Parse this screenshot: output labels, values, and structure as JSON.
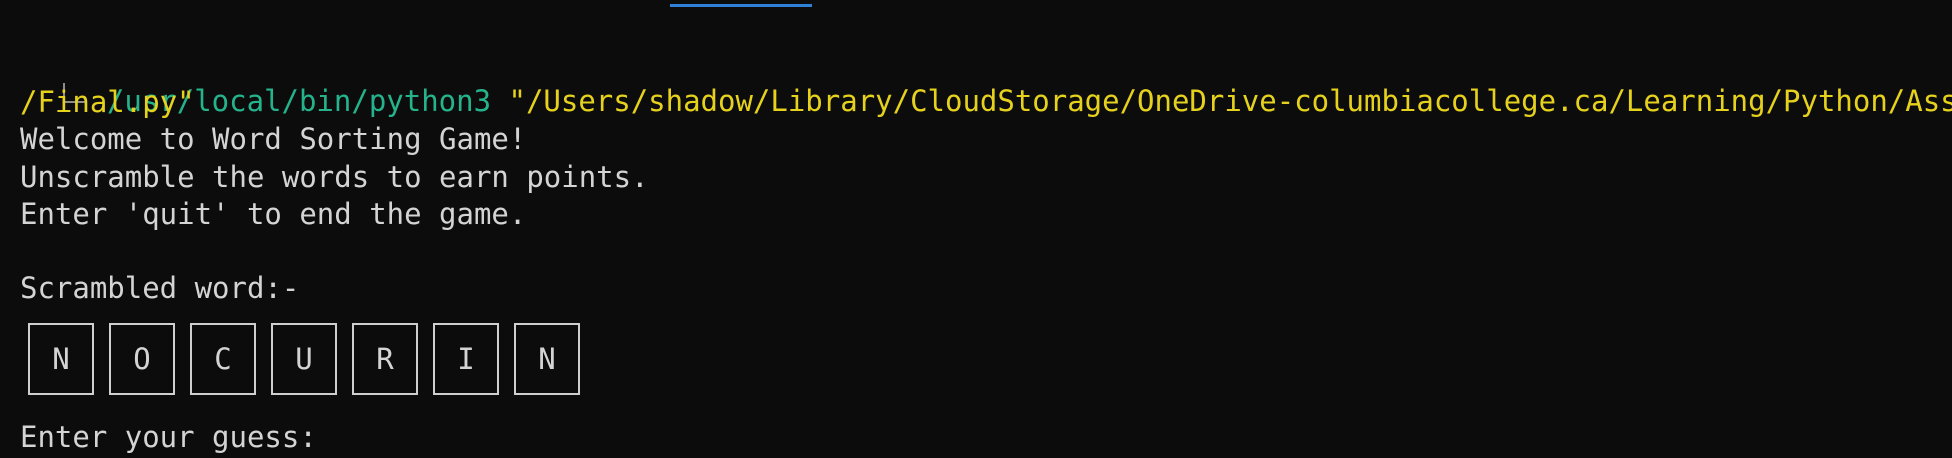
{
  "terminal": {
    "interpreter": "/usr/local/bin/python3",
    "script_path_line1": "\"/Users/shadow/Library/CloudStorage/OneDrive-columbiacollege.ca/Learning/Python/Assignme",
    "script_path_line2": "/Final.py\"",
    "welcome": "Welcome to Word Sorting Game!",
    "instruction": "Unscramble the words to earn points.",
    "quit_hint": "Enter 'quit' to end the game.",
    "scrambled_label": "Scrambled word:-",
    "letters": [
      "N",
      "O",
      "C",
      "U",
      "R",
      "I",
      "N"
    ],
    "guess_prompt": "Enter your guess:"
  },
  "colors": {
    "background": "#0c0c0c",
    "text": "#d4d4d4",
    "interpreter_path": "#25b38c",
    "script_path": "#e6d21d",
    "tile_border": "#cfcfcf",
    "top_underline": "#2f80d7"
  },
  "icons": {
    "prompt_corner": "tree-corner-icon"
  }
}
